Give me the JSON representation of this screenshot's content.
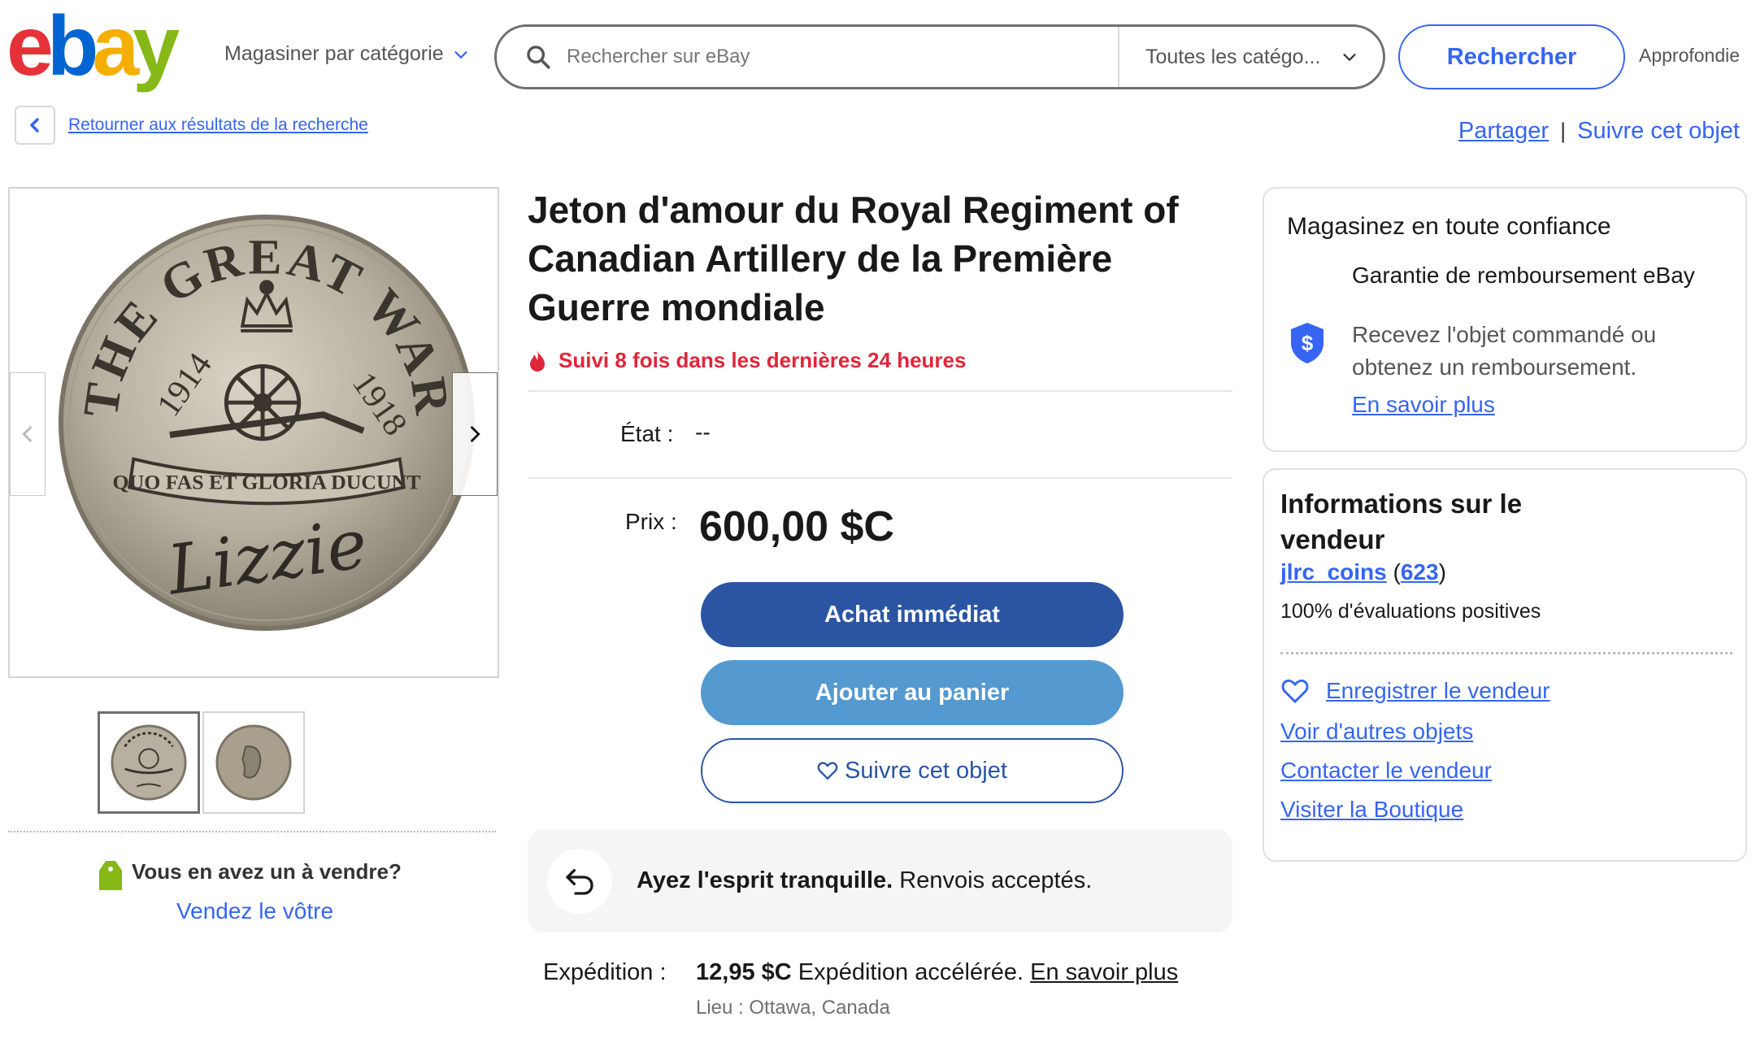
{
  "header": {
    "logo_alt": "ebay",
    "shop_by_category": "Magasiner par catégorie",
    "search_placeholder": "Rechercher sur eBay",
    "category_selected": "Toutes les catégo...",
    "search_button": "Rechercher",
    "advanced": "Approfondie"
  },
  "nav": {
    "back_link": "Retourner aux résultats de la recherche",
    "share": "Partager",
    "separator": "|",
    "watch_item": "Suivre cet objet"
  },
  "gallery": {
    "coin_text_top": "THE GREAT WAR",
    "coin_year_left": "1914",
    "coin_year_right": "1918",
    "coin_ribbon": "QUO FAS ET GLORIA DUCUNT",
    "coin_name": "Lizzie",
    "thumbnails": [
      "front",
      "back"
    ],
    "sell_question": "Vous en avez un à vendre?",
    "sell_link": "Vendez le vôtre"
  },
  "item": {
    "title": "Jeton d'amour du Royal Regiment of Canadian Artillery de la Première Guerre mondiale",
    "watch_alert": "Suivi 8 fois dans les dernières 24 heures",
    "condition_label": "État :",
    "condition_value": "--",
    "price_label": "Prix :",
    "price_value": "600,00 $C",
    "buy_now": "Achat immédiat",
    "add_to_cart": "Ajouter au panier",
    "watch_button": "Suivre cet objet",
    "returns_bold": "Ayez l'esprit tranquille.",
    "returns_text": " Renvois acceptés.",
    "shipping_label": "Expédition :",
    "shipping_cost": "12,95 $C",
    "shipping_method": " Expédition accélérée. ",
    "shipping_more": "En savoir plus",
    "location": "Lieu : Ottawa, Canada"
  },
  "trust": {
    "title": "Magasinez en toute confiance",
    "guarantee": "Garantie de remboursement eBay",
    "description": "Recevez l'objet commandé ou obtenez un remboursement.",
    "learn_more": "En savoir plus"
  },
  "seller": {
    "title": "Informations sur le vendeur",
    "name": "jlrc_coins",
    "score_open": " (",
    "score": "623",
    "score_close": ")",
    "feedback": "100% d'évaluations positives",
    "save_seller": "Enregistrer le vendeur",
    "other_items": "Voir d'autres objets",
    "contact": "Contacter le vendeur",
    "store": "Visiter la Boutique"
  },
  "colors": {
    "ebay_red": "#e53238",
    "ebay_blue": "#0064d2",
    "ebay_yellow": "#f5af02",
    "ebay_green": "#86b817",
    "link_blue": "#3665f3",
    "buy_button": "#2b55a3",
    "cart_button": "#5499cf",
    "alert_red": "#e0263a"
  }
}
